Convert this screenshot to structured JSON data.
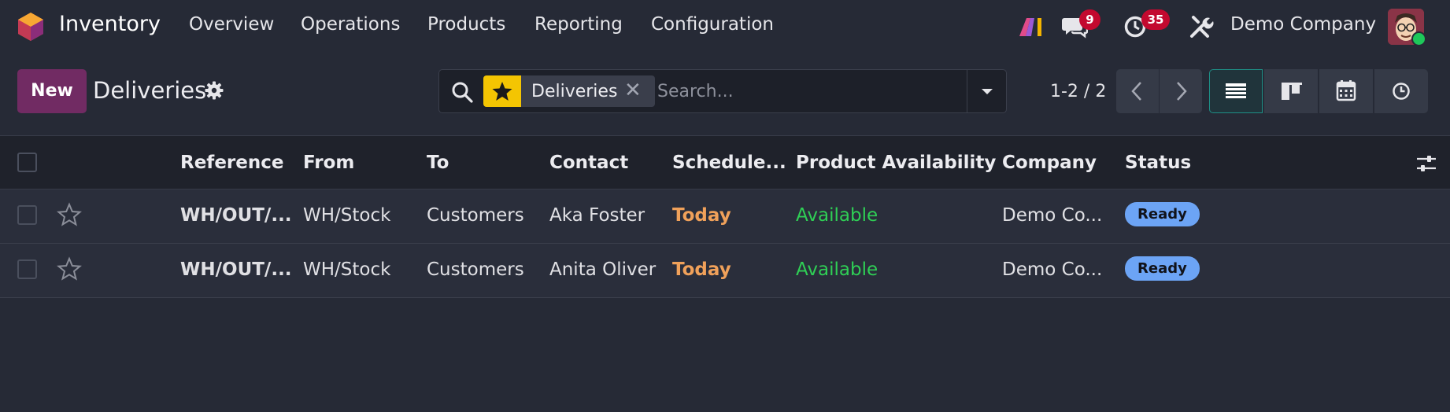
{
  "app": {
    "name": "Inventory",
    "menu": [
      "Overview",
      "Operations",
      "Products",
      "Reporting",
      "Configuration"
    ],
    "company": "Demo Company",
    "messages_count": "9",
    "activities_count": "35",
    "icons": [
      "odoo-logo-icon",
      "ai-icon",
      "chat-icon",
      "clock-icon",
      "tools-icon"
    ]
  },
  "control": {
    "new_label": "New",
    "title": "Deliveries",
    "facet_label": "Deliveries",
    "search_placeholder": "Search...",
    "pager": "1-2 / 2"
  },
  "table": {
    "columns": [
      "Reference",
      "From",
      "To",
      "Contact",
      "Schedule...",
      "Product Availability",
      "Company",
      "Status"
    ],
    "rows": [
      {
        "reference": "WH/OUT/...",
        "from": "WH/Stock",
        "to": "Customers",
        "contact": "Aka Foster",
        "scheduled": "Today",
        "availability": "Available",
        "company": "Demo Co...",
        "status": "Ready"
      },
      {
        "reference": "WH/OUT/...",
        "from": "WH/Stock",
        "to": "Customers",
        "contact": "Anita Oliver",
        "scheduled": "Today",
        "availability": "Available",
        "company": "Demo Co...",
        "status": "Ready"
      }
    ]
  },
  "colors": {
    "background": "#262a36",
    "primary": "#712b63",
    "badge_red": "#c3092f",
    "today_orange": "#f0a15a",
    "available_green": "#2fcf55",
    "ready_blue": "#6ca4f5",
    "facet_yellow": "#f4c502"
  }
}
